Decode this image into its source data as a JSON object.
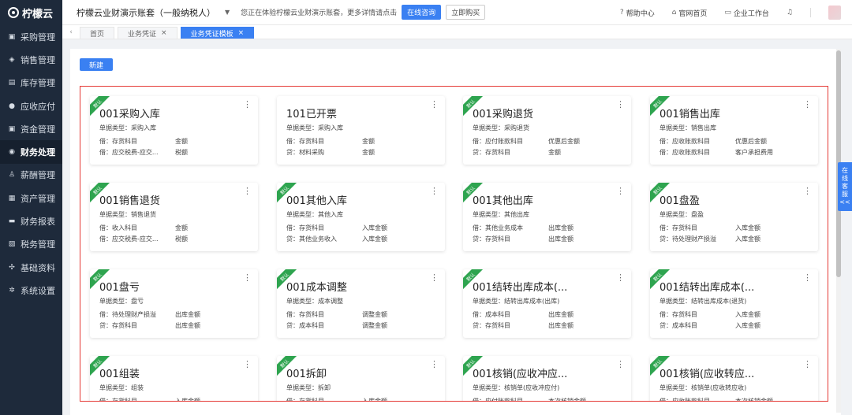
{
  "brand": {
    "name": "柠檬云"
  },
  "sidebar": {
    "items": [
      {
        "label": "采购管理",
        "icon": "cart-icon",
        "active": false
      },
      {
        "label": "销售管理",
        "icon": "tag-icon",
        "active": false
      },
      {
        "label": "库存管理",
        "icon": "warehouse-icon",
        "active": false
      },
      {
        "label": "应收应付",
        "icon": "coin-icon",
        "active": false
      },
      {
        "label": "资金管理",
        "icon": "wallet-icon",
        "active": false
      },
      {
        "label": "财务处理",
        "icon": "finance-icon",
        "active": true
      },
      {
        "label": "薪酬管理",
        "icon": "user-icon",
        "active": false
      },
      {
        "label": "资产管理",
        "icon": "asset-icon",
        "active": false
      },
      {
        "label": "财务报表",
        "icon": "report-icon",
        "active": false
      },
      {
        "label": "税务管理",
        "icon": "tax-icon",
        "active": false
      },
      {
        "label": "基础资料",
        "icon": "gear-icon",
        "active": false
      },
      {
        "label": "系统设置",
        "icon": "settings-icon",
        "active": false
      }
    ]
  },
  "header": {
    "account": "柠檬云业财演示账套（一般纳税人）",
    "notice": "您正在体验柠檬云业财演示账套，更多详情请点击",
    "consult_label": "在线咨询",
    "buy_label": "立即购买",
    "help_label": "帮助中心",
    "official_label": "官网首页",
    "workspace_label": "企业工作台"
  },
  "tabs": [
    {
      "label": "首页",
      "active": false,
      "closable": false
    },
    {
      "label": "业务凭证",
      "active": false,
      "closable": true
    },
    {
      "label": "业务凭证模板",
      "active": true,
      "closable": true
    }
  ],
  "toolbar": {
    "new_label": "新建"
  },
  "service_tab": {
    "line1": "在",
    "line2": "线",
    "line3": "客",
    "line4": "服",
    "arrow": "<<"
  },
  "cards": [
    {
      "badge": "默认",
      "title": "001采购入库",
      "type": "单据类型：采购入库",
      "line1_acct": "借：存货科目",
      "line1_amt": "金额",
      "line2_acct": "借：应交税费-应交...",
      "line2_amt": "税额"
    },
    {
      "badge": "",
      "title": "101已开票",
      "type": "单据类型：采购入库",
      "line1_acct": "借：存货科目",
      "line1_amt": "金额",
      "line2_acct": "贷：材料采购",
      "line2_amt": "金额"
    },
    {
      "badge": "默认",
      "title": "001采购退货",
      "type": "单据类型：采购退货",
      "line1_acct": "借：应付账款科目",
      "line1_amt": "优惠后金额",
      "line2_acct": "贷：存货科目",
      "line2_amt": "金额"
    },
    {
      "badge": "默认",
      "title": "001销售出库",
      "type": "单据类型：销售出库",
      "line1_acct": "借：应收账款科目",
      "line1_amt": "优惠后金额",
      "line2_acct": "借：应收账款科目",
      "line2_amt": "客户承担费用"
    },
    {
      "badge": "默认",
      "title": "001销售退货",
      "type": "单据类型：销售退货",
      "line1_acct": "借：收入科目",
      "line1_amt": "金额",
      "line2_acct": "借：应交税费-应交...",
      "line2_amt": "税额"
    },
    {
      "badge": "默认",
      "title": "001其他入库",
      "type": "单据类型：其他入库",
      "line1_acct": "借：存货科目",
      "line1_amt": "入库金额",
      "line2_acct": "贷：其他业务收入",
      "line2_amt": "入库金额"
    },
    {
      "badge": "默认",
      "title": "001其他出库",
      "type": "单据类型：其他出库",
      "line1_acct": "借：其他业务成本",
      "line1_amt": "出库金额",
      "line2_acct": "贷：存货科目",
      "line2_amt": "出库金额"
    },
    {
      "badge": "默认",
      "title": "001盘盈",
      "type": "单据类型：盘盈",
      "line1_acct": "借：存货科目",
      "line1_amt": "入库金额",
      "line2_acct": "贷：待处理财产损溢",
      "line2_amt": "入库金额"
    },
    {
      "badge": "默认",
      "title": "001盘亏",
      "type": "单据类型：盘亏",
      "line1_acct": "借：待处理财产损溢",
      "line1_amt": "出库金额",
      "line2_acct": "贷：存货科目",
      "line2_amt": "出库金额"
    },
    {
      "badge": "默认",
      "title": "001成本调整",
      "type": "单据类型：成本调整",
      "line1_acct": "借：存货科目",
      "line1_amt": "调整金额",
      "line2_acct": "贷：成本科目",
      "line2_amt": "调整金额"
    },
    {
      "badge": "默认",
      "title": "001结转出库成本(...",
      "type": "单据类型：结转出库成本(出库)",
      "line1_acct": "借：成本科目",
      "line1_amt": "出库金额",
      "line2_acct": "贷：存货科目",
      "line2_amt": "出库金额"
    },
    {
      "badge": "默认",
      "title": "001结转出库成本(...",
      "type": "单据类型：结转出库成本(退货)",
      "line1_acct": "借：存货科目",
      "line1_amt": "入库金额",
      "line2_acct": "贷：成本科目",
      "line2_amt": "入库金额"
    },
    {
      "badge": "默认",
      "title": "001组装",
      "type": "单据类型：组装",
      "line1_acct": "借：存货科目",
      "line1_amt": "入库金额",
      "line2_acct": "",
      "line2_amt": ""
    },
    {
      "badge": "默认",
      "title": "001拆卸",
      "type": "单据类型：拆卸",
      "line1_acct": "借：存货科目",
      "line1_amt": "入库金额",
      "line2_acct": "",
      "line2_amt": ""
    },
    {
      "badge": "默认",
      "title": "001核销(应收冲应...",
      "type": "单据类型：核销单(应收冲应付)",
      "line1_acct": "借：应付账款科目",
      "line1_amt": "本次核销金额",
      "line2_acct": "",
      "line2_amt": ""
    },
    {
      "badge": "默认",
      "title": "001核销(应收转应...",
      "type": "单据类型：核销单(应收转应收)",
      "line1_acct": "借：应收账款科目",
      "line1_amt": "本次核销金额",
      "line2_acct": "",
      "line2_amt": ""
    }
  ]
}
